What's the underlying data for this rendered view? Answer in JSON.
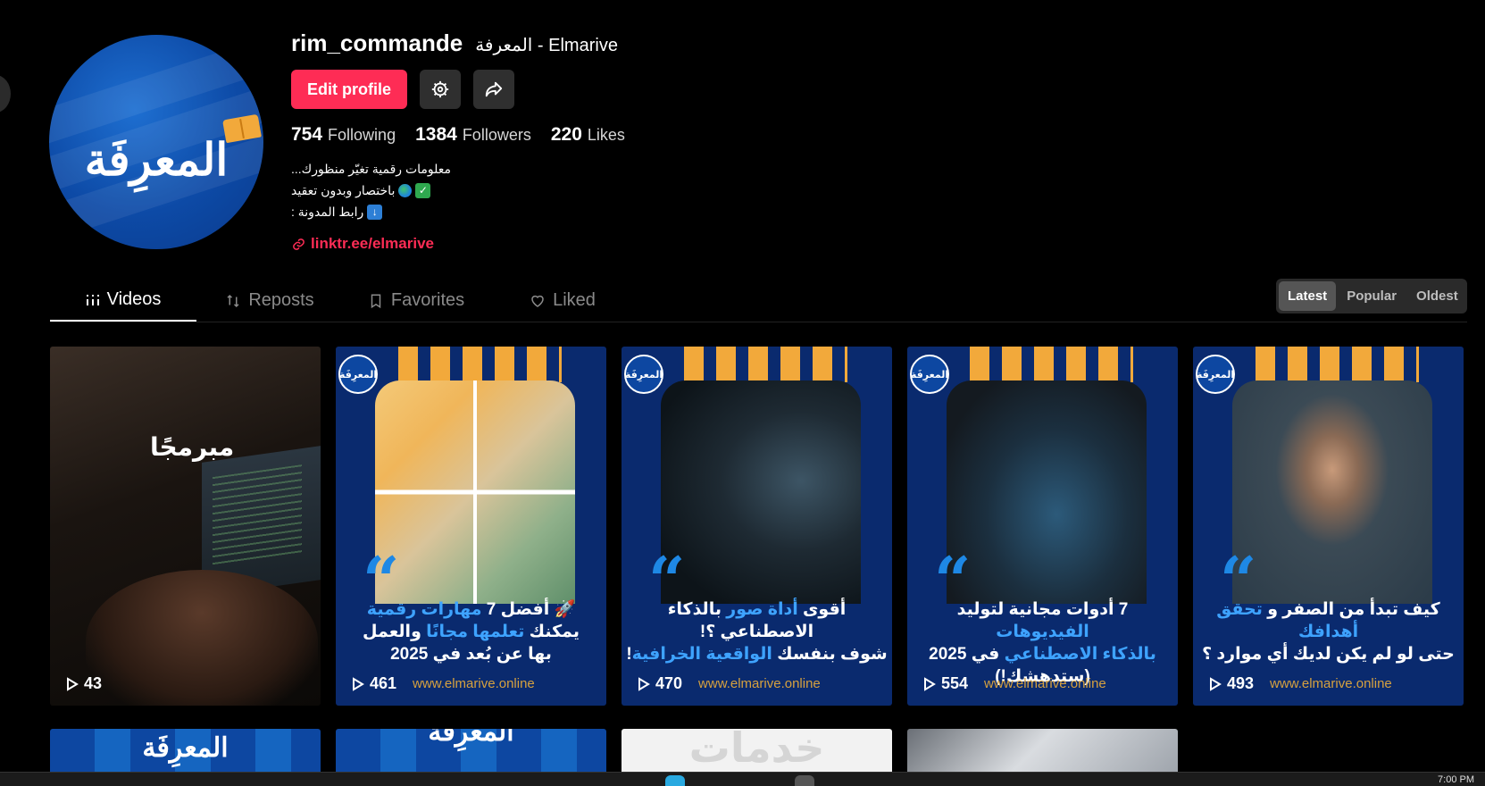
{
  "profile": {
    "username": "rim_commande",
    "nickname": "المعرفة - Elmarive",
    "avatar_text": "المعرِفَة",
    "edit_label": "Edit profile",
    "stats": [
      {
        "num": "754",
        "label": "Following"
      },
      {
        "num": "1384",
        "label": "Followers"
      },
      {
        "num": "220",
        "label": "Likes"
      }
    ],
    "bio": [
      "...معلومات رقمية تغيّر منظورك",
      "باختصار وبدون تعقيد",
      ": رابط المدونة"
    ],
    "link": "linktr.ee/elmarive",
    "accent": "#fe2c55"
  },
  "tabs": [
    "Videos",
    "Reposts",
    "Favorites",
    "Liked"
  ],
  "sort": [
    "Latest",
    "Popular",
    "Oldest"
  ],
  "videos": [
    {
      "views": "43",
      "overlay": "مبرمجًا"
    },
    {
      "views": "461",
      "site": "www.elmarive.online",
      "badge": "المعرِفَة",
      "title_hl1": "مهارات رقمية",
      "title_pre": "🚀 أفضل 7 ",
      "title_l2a": "يمكنك ",
      "title_hl2": "تعلمها مجانًا",
      "title_l2b": " والعمل",
      "title_l3": "بها عن بُعد في 2025"
    },
    {
      "views": "470",
      "site": "www.elmarive.online",
      "badge": "المعرِفَة",
      "title_pre": "أقوى ",
      "title_hl1": "أداة صور",
      "title_l1b": " بالذكاء الاصطناعي ؟!",
      "title_l2a": "شوف بنفسك ",
      "title_hl2": "الواقعية الخرافية",
      "title_l2b": "!"
    },
    {
      "views": "554",
      "site": "www.elmarive.online",
      "badge": "المعرِفَة",
      "title_pre": "7 أدوات مجانية لتوليد ",
      "title_hl1": "الفيديوهات",
      "title_hl2": "بالذكاء الاصطناعي",
      "title_l2b": " في 2025",
      "title_l3": "(ستدهشك!)"
    },
    {
      "views": "493",
      "site": "www.elmarive.online",
      "badge": "المعرِفَة",
      "title_pre": "كيف تبدأ من الصفر و ",
      "title_hl1": "تحقق أهدافك",
      "title_l2a": "حتى لو لم يكن لديك أي موارد ؟"
    }
  ],
  "row2": [
    {
      "label": "المعرِفَة"
    },
    {
      "label": "المعرِفَة"
    },
    {
      "label": "خدمات"
    },
    {
      "label": ""
    }
  ],
  "taskbar": {
    "time": "7:00 PM"
  }
}
